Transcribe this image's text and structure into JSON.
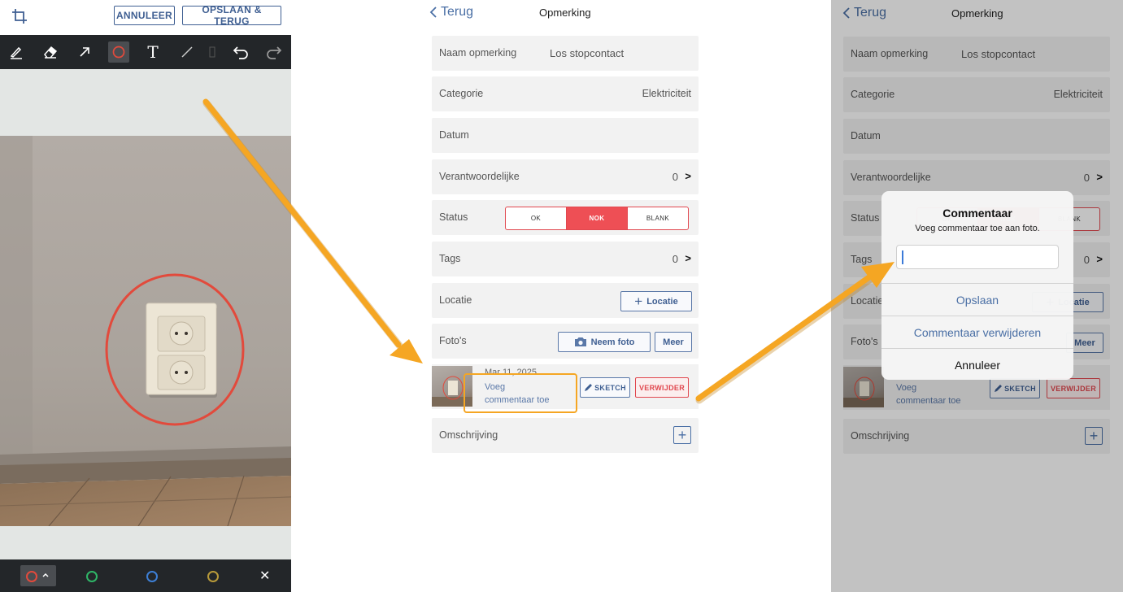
{
  "editor": {
    "cancel_label": "ANNULEER",
    "save_label": "OPSLAAN & TERUG",
    "tools": [
      "crop-icon",
      "pen-icon",
      "eraser-icon",
      "arrow-icon",
      "circle-icon",
      "text-icon",
      "line-icon",
      "undo-icon",
      "redo-icon"
    ],
    "active_tool": "circle-icon",
    "palette": [
      {
        "name": "red",
        "color": "#e24a3c",
        "selected": true
      },
      {
        "name": "green",
        "color": "#2fb567"
      },
      {
        "name": "blue",
        "color": "#3d7fd6"
      },
      {
        "name": "yellow",
        "color": "#b89a3a"
      }
    ],
    "close_glyph": "✕",
    "text_tool_glyph": "T"
  },
  "form": {
    "back_label": "Terug",
    "title": "Opmerking",
    "name_label": "Naam opmerking",
    "name_value": "Los stopcontact",
    "category_label": "Categorie",
    "category_value": "Elektriciteit",
    "date_label": "Datum",
    "responsible_label": "Verantwoordelijke",
    "responsible_count": "0",
    "status_label": "Status",
    "status_options": [
      "OK",
      "NOK",
      "BLANK"
    ],
    "status_selected": "NOK",
    "tags_label": "Tags",
    "tags_count": "0",
    "location_label": "Locatie",
    "location_button": "Locatie",
    "photos_label": "Foto's",
    "take_photo_button": "Neem foto",
    "more_button": "Meer",
    "photo_date": "Mar 11, 2025",
    "add_comment_link_line1": "Voeg",
    "add_comment_link_line2": "commentaar toe",
    "sketch_button": "SKETCH",
    "delete_button": "VERWIJDER",
    "description_label": "Omschrijving",
    "chevron": ">",
    "plus": "+"
  },
  "dialog": {
    "title": "Commentaar",
    "message": "Voeg commentaar toe aan foto.",
    "input_value": "",
    "save_label": "Opslaan",
    "remove_label": "Commentaar verwijderen",
    "cancel_label": "Annuleer"
  },
  "colors": {
    "accent": "#3f5f92",
    "status_red": "#ee4f55",
    "highlight_orange": "#f5a623"
  }
}
